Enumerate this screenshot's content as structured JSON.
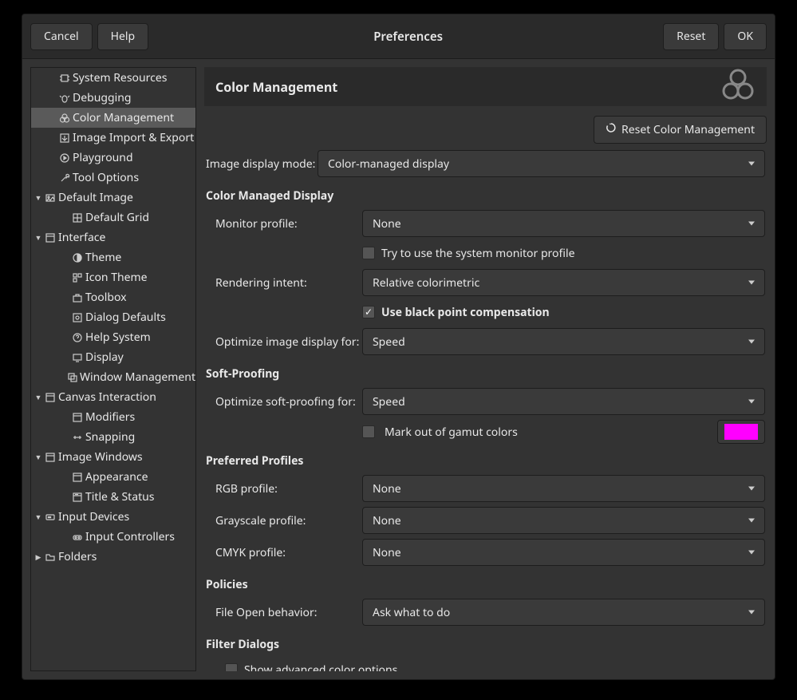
{
  "window": {
    "title": "Preferences",
    "buttons": {
      "cancel": "Cancel",
      "help": "Help",
      "reset": "Reset",
      "ok": "OK"
    }
  },
  "sidebar": {
    "items": [
      {
        "label": "System Resources",
        "level": 1,
        "icon": "chip"
      },
      {
        "label": "Debugging",
        "level": 1,
        "icon": "bug"
      },
      {
        "label": "Color Management",
        "level": 1,
        "icon": "circles",
        "selected": true
      },
      {
        "label": "Image Import & Export",
        "level": 1,
        "icon": "import"
      },
      {
        "label": "Playground",
        "level": 1,
        "icon": "play"
      },
      {
        "label": "Tool Options",
        "level": 1,
        "icon": "tools"
      },
      {
        "label": "Default Image",
        "level": 0,
        "icon": "image",
        "arrow": "down"
      },
      {
        "label": "Default Grid",
        "level": 2,
        "icon": "grid"
      },
      {
        "label": "Interface",
        "level": 0,
        "icon": "window",
        "arrow": "down"
      },
      {
        "label": "Theme",
        "level": 2,
        "icon": "theme"
      },
      {
        "label": "Icon Theme",
        "level": 2,
        "icon": "icons"
      },
      {
        "label": "Toolbox",
        "level": 2,
        "icon": "toolbox"
      },
      {
        "label": "Dialog Defaults",
        "level": 2,
        "icon": "dialog"
      },
      {
        "label": "Help System",
        "level": 2,
        "icon": "help"
      },
      {
        "label": "Display",
        "level": 2,
        "icon": "display"
      },
      {
        "label": "Window Management",
        "level": 2,
        "icon": "wm"
      },
      {
        "label": "Canvas Interaction",
        "level": 0,
        "icon": "window",
        "arrow": "down"
      },
      {
        "label": "Modifiers",
        "level": 2,
        "icon": "window"
      },
      {
        "label": "Snapping",
        "level": 2,
        "icon": "snap"
      },
      {
        "label": "Image Windows",
        "level": 0,
        "icon": "window",
        "arrow": "down"
      },
      {
        "label": "Appearance",
        "level": 2,
        "icon": "window"
      },
      {
        "label": "Title & Status",
        "level": 2,
        "icon": "title"
      },
      {
        "label": "Input Devices",
        "level": 0,
        "icon": "input",
        "arrow": "down"
      },
      {
        "label": "Input Controllers",
        "level": 2,
        "icon": "controller"
      },
      {
        "label": "Folders",
        "level": 0,
        "icon": "folder",
        "arrow": "right"
      }
    ]
  },
  "page": {
    "title": "Color Management",
    "reset_button": "Reset Color Management",
    "image_display_mode": {
      "label": "Image display mode:",
      "value": "Color-managed display"
    },
    "section_color_managed": "Color Managed Display",
    "monitor_profile": {
      "label": "Monitor profile:",
      "value": "None"
    },
    "try_system_profile": {
      "label": "Try to use the system monitor profile",
      "checked": false
    },
    "rendering_intent": {
      "label": "Rendering intent:",
      "value": "Relative colorimetric"
    },
    "black_point": {
      "label": "Use black point compensation",
      "checked": true
    },
    "optimize_display": {
      "label": "Optimize image display for:",
      "value": "Speed"
    },
    "section_softproof": "Soft-Proofing",
    "optimize_softproof": {
      "label": "Optimize soft-proofing for:",
      "value": "Speed"
    },
    "mark_gamut": {
      "label": "Mark out of gamut colors",
      "checked": false,
      "color": "#ff00ff"
    },
    "section_preferred": "Preferred Profiles",
    "rgb_profile": {
      "label": "RGB profile:",
      "value": "None"
    },
    "gray_profile": {
      "label": "Grayscale profile:",
      "value": "None"
    },
    "cmyk_profile": {
      "label": "CMYK profile:",
      "value": "None"
    },
    "section_policies": "Policies",
    "file_open": {
      "label": "File Open behavior:",
      "value": "Ask what to do"
    },
    "section_filter": "Filter Dialogs",
    "show_advanced": {
      "label": "Show advanced color options",
      "checked": false
    }
  }
}
